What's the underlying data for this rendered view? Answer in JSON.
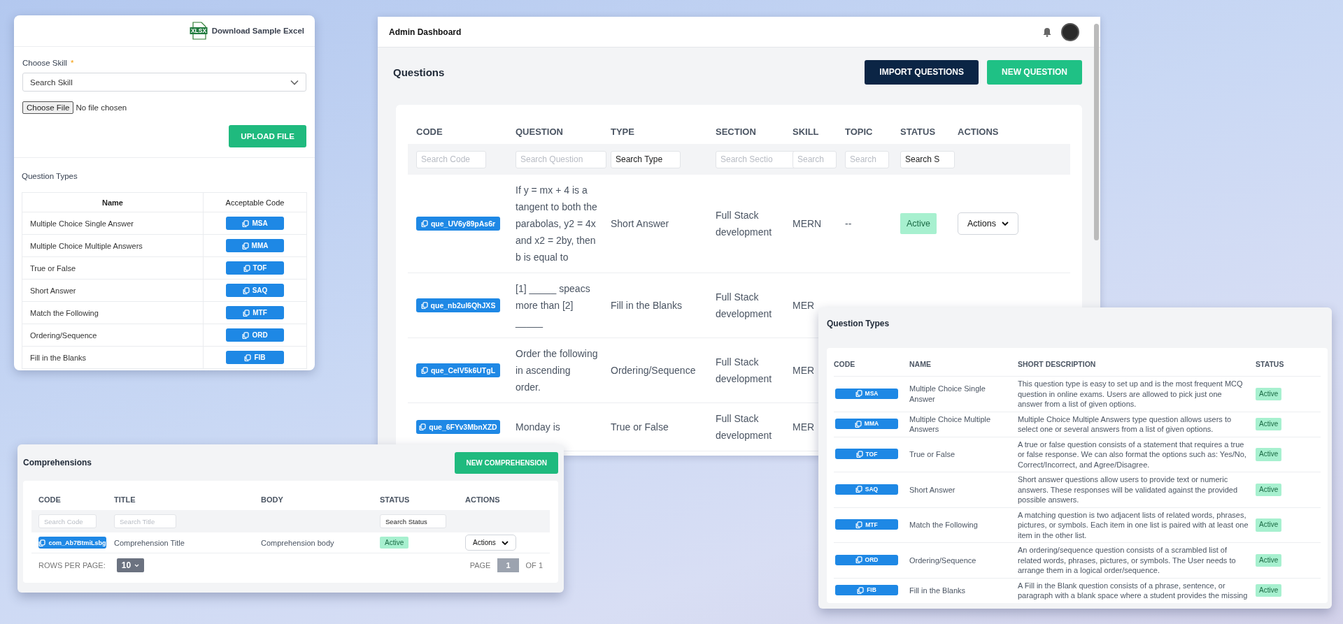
{
  "upload_panel": {
    "download_link": {
      "label": "Download Sample Excel",
      "icon_label": "XLSX"
    },
    "skill_field": {
      "label": "Choose Skill",
      "required_mark": "*",
      "placeholder": "Search Skill"
    },
    "file_input": {
      "button": "Choose File",
      "status": "No file chosen"
    },
    "upload_button": "UPLOAD FILE",
    "question_types": {
      "title": "Question Types",
      "columns": [
        "Name",
        "Acceptable Code"
      ],
      "rows": [
        {
          "name": "Multiple Choice Single Answer",
          "code": "MSA"
        },
        {
          "name": "Multiple Choice Multiple Answers",
          "code": "MMA"
        },
        {
          "name": "True or False",
          "code": "TOF"
        },
        {
          "name": "Short Answer",
          "code": "SAQ"
        },
        {
          "name": "Match the Following",
          "code": "MTF"
        },
        {
          "name": "Ordering/Sequence",
          "code": "ORD"
        },
        {
          "name": "Fill in the Blanks",
          "code": "FIB"
        }
      ]
    }
  },
  "dashboard": {
    "title": "Admin Dashboard",
    "page_title": "Questions",
    "buttons": [
      {
        "label": "IMPORT QUESTIONS",
        "kind": "primary"
      },
      {
        "label": "NEW QUESTION",
        "kind": "success"
      }
    ],
    "table": {
      "columns": [
        "CODE",
        "QUESTION",
        "TYPE",
        "SECTION",
        "SKILL",
        "TOPIC",
        "STATUS",
        "ACTIONS"
      ],
      "filters": [
        {
          "kind": "input",
          "placeholder": "Search Code"
        },
        {
          "kind": "input",
          "placeholder": "Search Question"
        },
        {
          "kind": "select",
          "value": "Search Type"
        },
        {
          "kind": "input",
          "placeholder": "Search Sectio"
        },
        {
          "kind": "input",
          "placeholder": "Search"
        },
        {
          "kind": "input",
          "placeholder": "Search"
        },
        {
          "kind": "select",
          "value": "Search S"
        },
        {
          "kind": "empty"
        }
      ],
      "rows": [
        {
          "code": "que_UV6y89pAs6r",
          "question": "If y = mx + 4 is a tangent to both the parabolas, y2 = 4x and x2 = 2by, then b is equal to",
          "type": "Short Answer",
          "section": "Full Stack development",
          "skill": "MERN",
          "topic": "--",
          "status": "Active",
          "actions": "Actions"
        },
        {
          "code": "que_nb2ul6QhJXS",
          "question": "[1] _____ speacs more than [2] _____",
          "type": "Fill in the Blanks",
          "section": "Full Stack development",
          "skill": "MER"
        },
        {
          "code": "que_CelV5k6UTgL",
          "question": "Order the following in ascending order.",
          "type": "Ordering/Sequence",
          "section": "Full Stack development",
          "skill": "MER"
        },
        {
          "code": "que_6FYv3MbnXZD",
          "question": "Monday is",
          "type": "True or False",
          "section": "Full Stack development",
          "skill": "MER"
        }
      ]
    }
  },
  "comprehensions": {
    "title": "Comprehensions",
    "new_button": "NEW COMPREHENSION",
    "table": {
      "columns": [
        "CODE",
        "TITLE",
        "BODY",
        "STATUS",
        "ACTIONS"
      ],
      "filters": [
        {
          "kind": "input",
          "placeholder": "Search Code"
        },
        {
          "kind": "input",
          "placeholder": "Search Title"
        },
        {
          "kind": "empty"
        },
        {
          "kind": "select",
          "value": "Search Status"
        },
        {
          "kind": "empty"
        }
      ],
      "rows": [
        {
          "code": "com_Ab7BtmiLsbg",
          "title": "Comprehension Title",
          "body": "Comprehension body",
          "status": "Active",
          "actions": "Actions"
        }
      ]
    },
    "rows_per_page": {
      "label": "ROWS PER PAGE:",
      "value": "10"
    },
    "pagination": {
      "page_label": "PAGE",
      "page": "1",
      "of_label": "OF 1"
    }
  },
  "question_types_panel": {
    "title": "Question Types",
    "columns": [
      "CODE",
      "NAME",
      "SHORT DESCRIPTION",
      "STATUS"
    ],
    "rows": [
      {
        "code": "MSA",
        "name": "Multiple Choice Single Answer",
        "description": "This question type is easy to set up and is the most frequent MCQ question in online exams. Users are allowed to pick just one answer from a list of given options.",
        "status": "Active"
      },
      {
        "code": "MMA",
        "name": "Multiple Choice Multiple Answers",
        "description": "Multiple Choice Multiple Answers type question allows users to select one or several answers from a list of given options.",
        "status": "Active"
      },
      {
        "code": "TOF",
        "name": "True or False",
        "description": "A true or false question consists of a statement that requires a true or false response. We can also format the options such as: Yes/No, Correct/Incorrect, and Agree/Disagree.",
        "status": "Active"
      },
      {
        "code": "SAQ",
        "name": "Short Answer",
        "description": "Short answer questions allow users to provide text or numeric answers. These responses will be validated against the provided possible answers.",
        "status": "Active"
      },
      {
        "code": "MTF",
        "name": "Match the Following",
        "description": "A matching question is two adjacent lists of related words, phrases, pictures, or symbols. Each item in one list is paired with at least one item in the other list.",
        "status": "Active"
      },
      {
        "code": "ORD",
        "name": "Ordering/Sequence",
        "description": "An ordering/sequence question consists of a scrambled list of related words, phrases, pictures, or symbols. The User needs to arrange them in a logical order/sequence.",
        "status": "Active"
      },
      {
        "code": "FIB",
        "name": "Fill in the Blanks",
        "description": "A Fill in the Blank question consists of a phrase, sentence, or paragraph with a blank space where a student provides the missing",
        "status": "Active"
      }
    ]
  }
}
